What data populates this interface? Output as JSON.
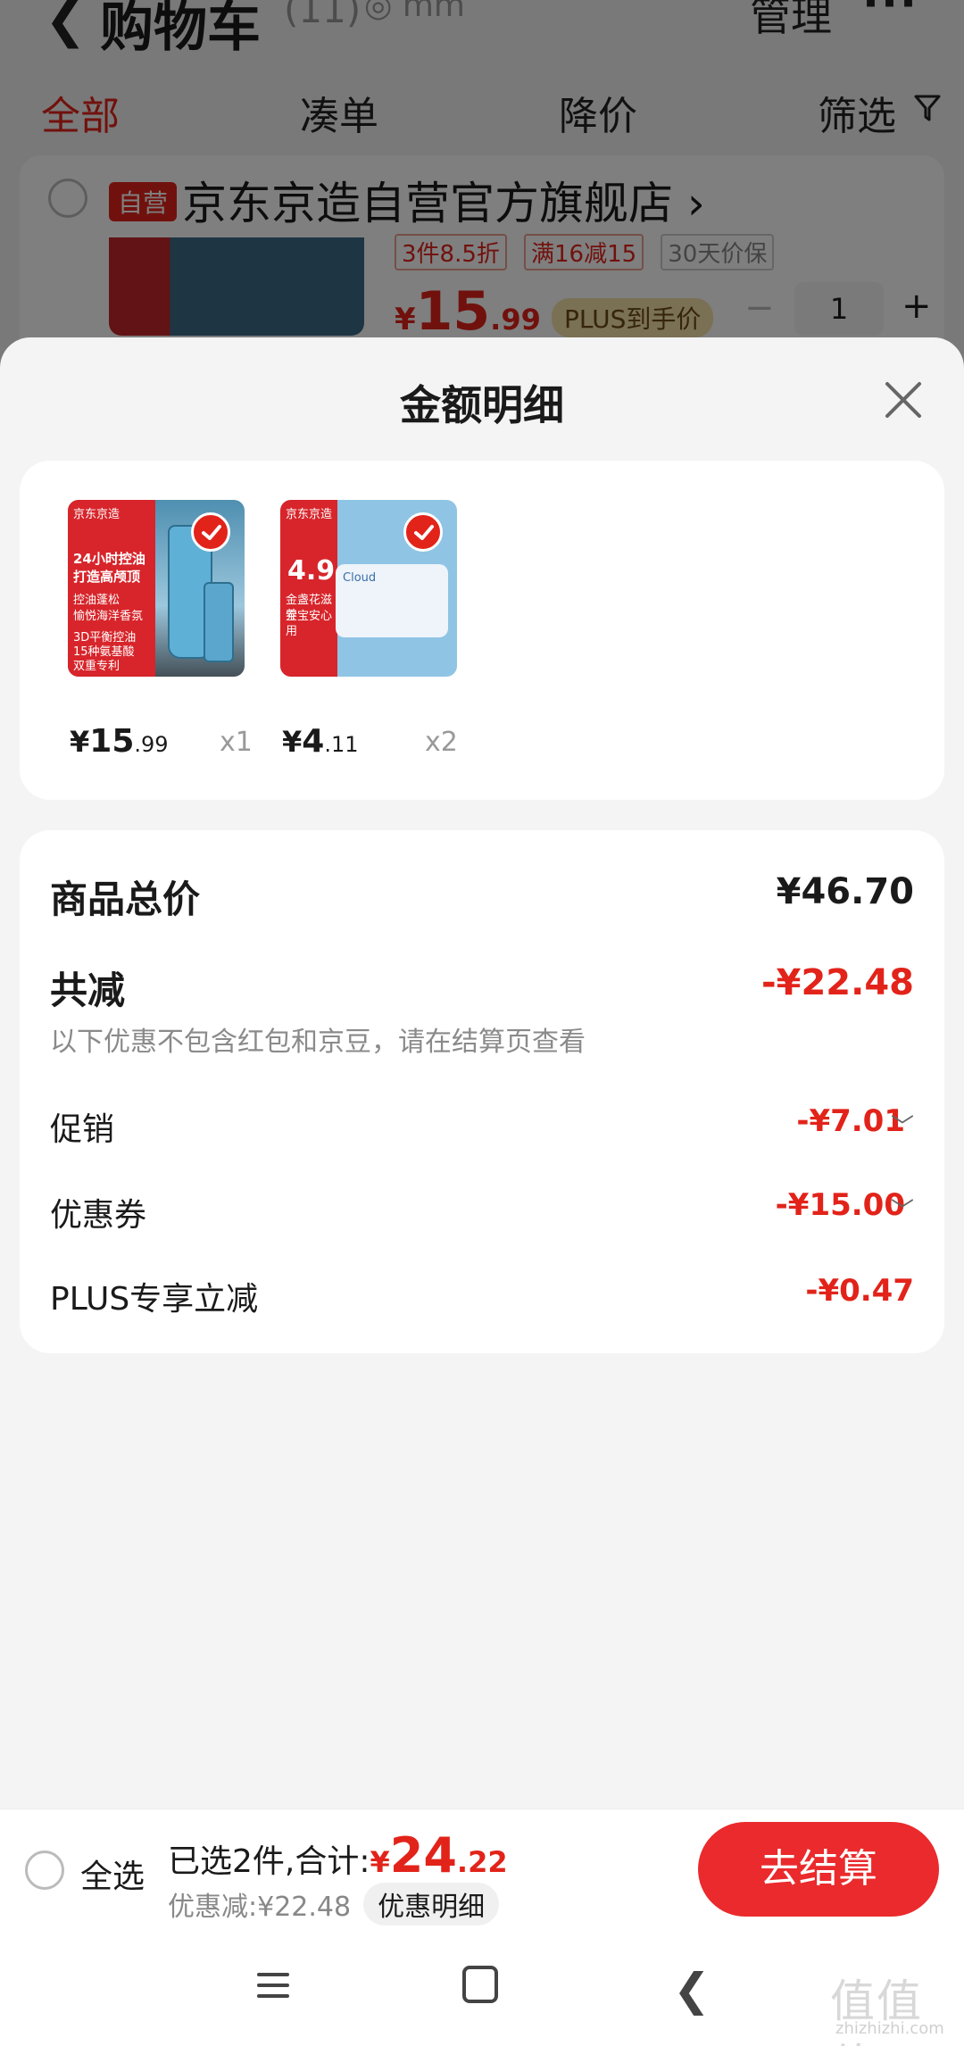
{
  "background": {
    "title": "购物车",
    "count": "(11)",
    "location": "◎ mm",
    "manage": "管理",
    "more": "···",
    "tabs": [
      "全部",
      "凑单",
      "降价",
      "筛选"
    ],
    "store": {
      "badge": "自营",
      "name": "京东京造自营官方旗舰店",
      "promo_tags": [
        "3件8.5折",
        "满16减15",
        "30天价保"
      ],
      "price_symbol": "¥",
      "price_int": "15",
      "price_dec": ".99",
      "plus_tag": "PLUS到手价",
      "qty": "1"
    }
  },
  "sheet": {
    "title": "金额明细",
    "products": [
      {
        "thumb_text": [
          "京东京造",
          "24小时控油",
          "打造高颅顶",
          "控油蓬松",
          "愉悦海洋香氛",
          "3D平衡控油",
          "15种氨基酸",
          "双重专利"
        ],
        "price_symbol": "¥",
        "price_int": "15",
        "price_dec": ".99",
        "qty": "x1"
      },
      {
        "thumb_text": [
          "京东京造",
          "4.9",
          "金盏花滋养",
          "宝宝安心用",
          "Cloud"
        ],
        "price_symbol": "¥",
        "price_int": "4",
        "price_dec": ".11",
        "qty": "x2"
      }
    ],
    "summary": {
      "total_label": "商品总价",
      "total_value": "¥46.70",
      "reduce_label": "共减",
      "reduce_value": "-¥22.48",
      "note": "以下优惠不包含红包和京豆，请在结算页查看",
      "promo_label": "促销",
      "promo_value": "-¥7.01",
      "coupon_label": "优惠券",
      "coupon_value": "-¥15.00",
      "plus_label": "PLUS专享立减",
      "plus_value": "-¥0.47"
    }
  },
  "bottom": {
    "select_all": "全选",
    "selected_text": "已选2件,合计:",
    "total_symbol": "¥",
    "total_int": "24",
    "total_dec": ".22",
    "discount_text": "优惠减:¥22.48",
    "detail_chip": "优惠明细",
    "checkout": "去结算"
  },
  "watermark": {
    "main": "值值值",
    "sub": "zhizhizhi.com"
  },
  "colors": {
    "accent": "#e2231a",
    "checkout": "#ea2a2c",
    "sheet_bg": "#f4f4f4"
  }
}
